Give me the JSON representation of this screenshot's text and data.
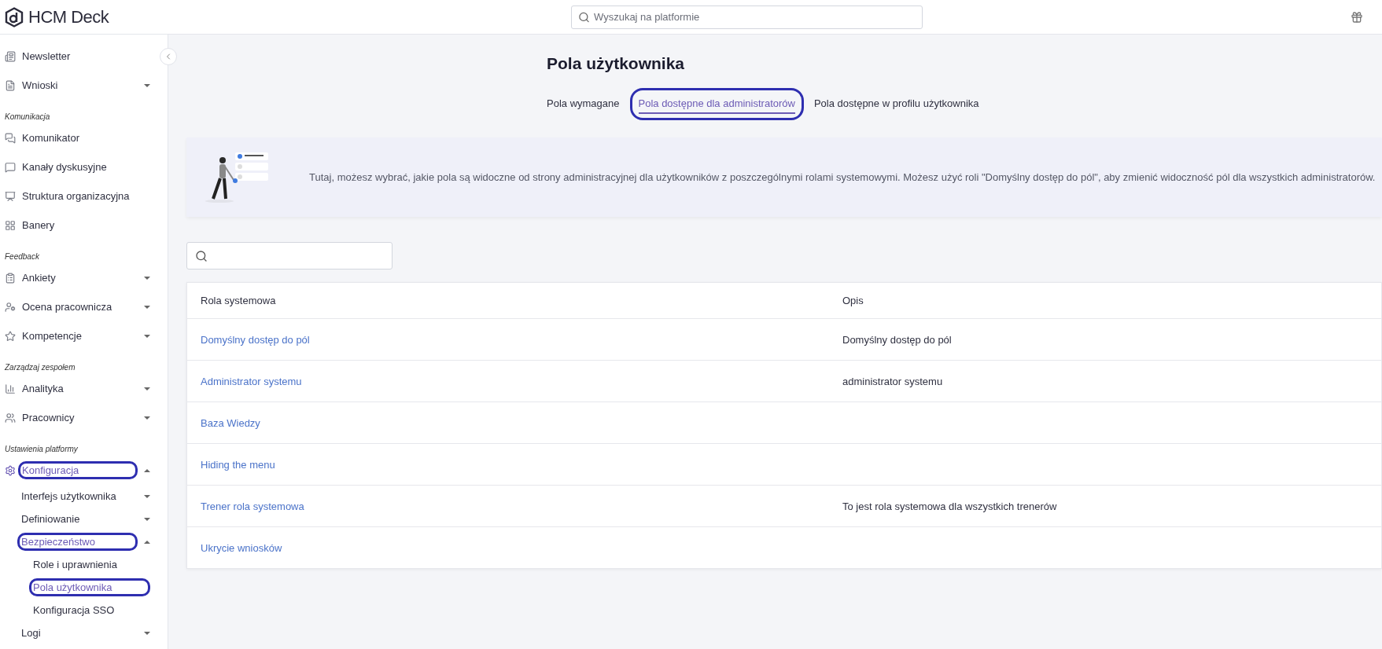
{
  "header": {
    "logo_text": "HCM Deck",
    "search": {
      "placeholder": "Wyszukaj na platformie"
    }
  },
  "sidebar": {
    "groups": [
      {
        "items": [
          {
            "label": "Newsletter",
            "kind": "link",
            "selected": false,
            "circled": false
          },
          {
            "label": "Wnioski",
            "kind": "menu",
            "expanded": false,
            "selected": false,
            "circled": false
          }
        ]
      },
      {
        "heading": "Komunikacja",
        "items": [
          {
            "label": "Komunikator",
            "kind": "link",
            "selected": false,
            "circled": false
          },
          {
            "label": "Kanały dyskusyjne",
            "kind": "link",
            "selected": false,
            "circled": false
          },
          {
            "label": "Struktura organizacyjna",
            "kind": "link",
            "selected": false,
            "circled": false
          },
          {
            "label": "Banery",
            "kind": "link",
            "selected": false,
            "circled": false
          }
        ]
      },
      {
        "heading": "Feedback",
        "items": [
          {
            "label": "Ankiety",
            "kind": "menu",
            "expanded": false,
            "selected": false,
            "circled": false
          },
          {
            "label": "Ocena pracownicza",
            "kind": "menu",
            "expanded": false,
            "selected": false,
            "circled": false
          },
          {
            "label": "Kompetencje",
            "kind": "menu",
            "expanded": false,
            "selected": false,
            "circled": false
          }
        ]
      },
      {
        "heading": "Zarządzaj zespołem",
        "items": [
          {
            "label": "Analityka",
            "kind": "menu",
            "expanded": false,
            "selected": false,
            "circled": false
          },
          {
            "label": "Pracownicy",
            "kind": "menu",
            "expanded": false,
            "selected": false,
            "circled": false
          }
        ]
      },
      {
        "heading": "Ustawienia platformy",
        "items": [
          {
            "label": "Konfiguracja",
            "kind": "menu",
            "expanded": true,
            "selected": true,
            "circled": true,
            "children": [
              {
                "label": "Interfejs użytkownika",
                "kind": "menu",
                "expanded": false,
                "selected": false,
                "circled": false
              },
              {
                "label": "Definiowanie",
                "kind": "menu",
                "expanded": false,
                "selected": false,
                "circled": false
              },
              {
                "label": "Bezpieczeństwo",
                "kind": "menu",
                "expanded": true,
                "selected": true,
                "circled": true,
                "children": [
                  {
                    "label": "Role i uprawnienia",
                    "kind": "link",
                    "selected": false,
                    "circled": false
                  },
                  {
                    "label": "Pola użytkownika",
                    "kind": "link",
                    "selected": true,
                    "circled": true
                  },
                  {
                    "label": "Konfiguracja SSO",
                    "kind": "link",
                    "selected": false,
                    "circled": false
                  }
                ]
              },
              {
                "label": "Logi",
                "kind": "menu",
                "expanded": false,
                "selected": false,
                "circled": false
              }
            ]
          }
        ]
      }
    ]
  },
  "page": {
    "title": "Pola użytkownika",
    "tabs": [
      {
        "label": "Pola wymagane",
        "selected": false,
        "circled": false
      },
      {
        "label": "Pola dostępne dla administratorów",
        "selected": true,
        "circled": true
      },
      {
        "label": "Pola dostępne w profilu użytkownika",
        "selected": false,
        "circled": false
      }
    ],
    "info": "Tutaj, możesz wybrać, jakie pola są widoczne od strony administracyjnej dla użytkowników z poszczególnymi rolami systemowymi. Możesz użyć roli \"Domyślny dostęp do pól\", aby zmienić widoczność pól dla wszystkich administratorów.",
    "table": {
      "columns": [
        "Rola systemowa",
        "Opis"
      ],
      "rows": [
        [
          "Domyślny dostęp do pól",
          "Domyślny dostęp do pól"
        ],
        [
          "Administrator systemu",
          "administrator systemu"
        ],
        [
          "Baza Wiedzy",
          ""
        ],
        [
          "Hiding the menu",
          ""
        ],
        [
          "Trener rola systemowa",
          "To jest rola systemowa dla wszystkich trenerów"
        ],
        [
          "Ukrycie wniosków",
          ""
        ]
      ]
    }
  }
}
